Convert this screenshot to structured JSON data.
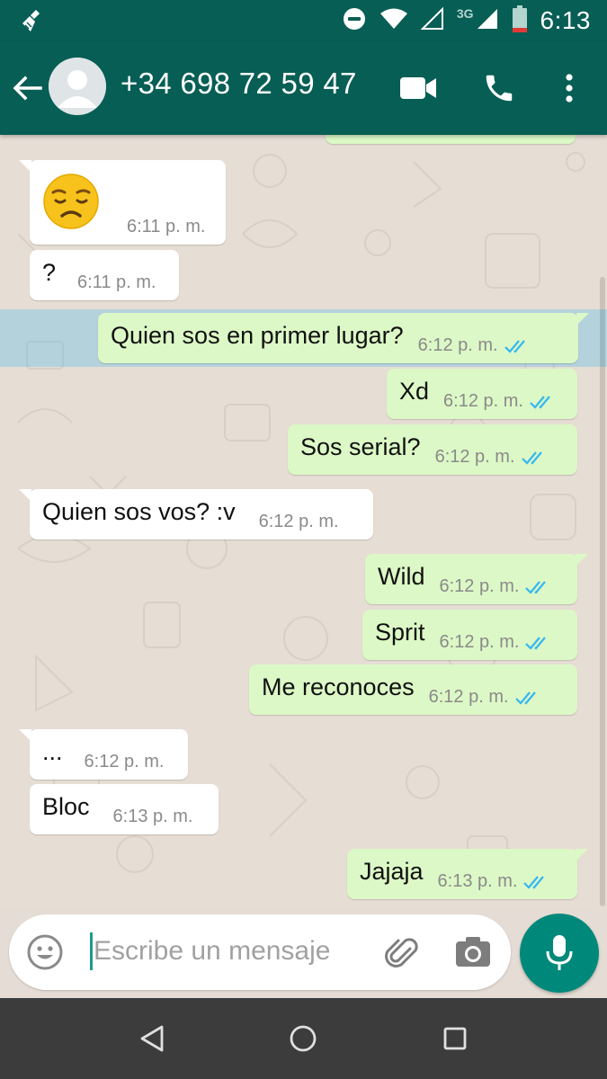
{
  "status_bar": {
    "time": "6:13",
    "network_label": "3G",
    "icons": [
      "broom-icon",
      "do-not-disturb-icon",
      "wifi-icon",
      "signal-empty-icon",
      "signal-icon",
      "battery-low-icon"
    ]
  },
  "header": {
    "title": "+34 698 72 59 47",
    "icons": [
      "back-arrow-icon",
      "avatar-placeholder-icon",
      "video-call-icon",
      "phone-call-icon",
      "more-vert-icon"
    ]
  },
  "messages": [
    {
      "dir": "in",
      "type": "emoji",
      "emoji": "disappointed-face",
      "time": "6:11 p. m."
    },
    {
      "dir": "in",
      "text": "?",
      "time": "6:11 p. m."
    },
    {
      "dir": "out",
      "text": "Quien sos en primer lugar?",
      "time": "6:12 p. m.",
      "status": "read",
      "highlighted": true
    },
    {
      "dir": "out",
      "text": "Xd",
      "time": "6:12 p. m.",
      "status": "read"
    },
    {
      "dir": "out",
      "text": "Sos serial?",
      "time": "6:12 p. m.",
      "status": "read"
    },
    {
      "dir": "in",
      "text": "Quien sos vos? :v",
      "time": "6:12 p. m."
    },
    {
      "dir": "out",
      "text": "Wild",
      "time": "6:12 p. m.",
      "status": "read"
    },
    {
      "dir": "out",
      "text": "Sprit",
      "time": "6:12 p. m.",
      "status": "read"
    },
    {
      "dir": "out",
      "text": "Me reconoces",
      "time": "6:12 p. m.",
      "status": "read"
    },
    {
      "dir": "in",
      "text": "...",
      "time": "6:12 p. m."
    },
    {
      "dir": "in",
      "text": "Bloc",
      "time": "6:13 p. m."
    },
    {
      "dir": "out",
      "text": "Jajaja",
      "time": "6:13 p. m.",
      "status": "read"
    }
  ],
  "composer": {
    "placeholder": "Escribe un mensaje",
    "icons": [
      "emoji-icon",
      "attach-icon",
      "camera-icon",
      "mic-icon"
    ]
  },
  "colors": {
    "header": "#075e54",
    "outgoing_bubble": "#dcf8c6",
    "incoming_bubble": "#ffffff",
    "read_ticks": "#34b7f1",
    "mic_button": "#00897b",
    "chat_bg": "#e6ddd4"
  },
  "nav_bar": {
    "icons": [
      "back-triangle-icon",
      "home-circle-icon",
      "recents-square-icon"
    ]
  }
}
